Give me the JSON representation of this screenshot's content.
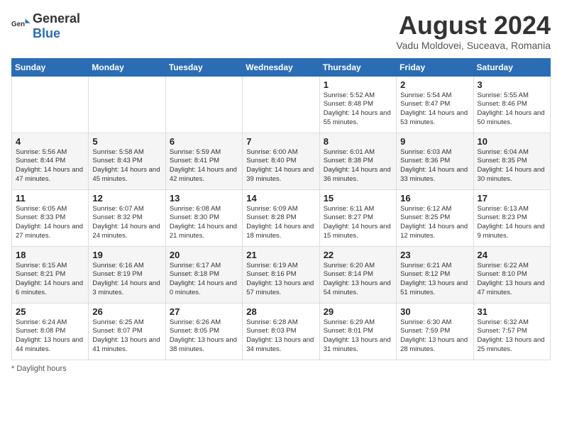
{
  "header": {
    "logo_general": "General",
    "logo_blue": "Blue",
    "month_year": "August 2024",
    "location": "Vadu Moldovei, Suceava, Romania"
  },
  "days_of_week": [
    "Sunday",
    "Monday",
    "Tuesday",
    "Wednesday",
    "Thursday",
    "Friday",
    "Saturday"
  ],
  "footer": {
    "daylight_label": "Daylight hours"
  },
  "weeks": [
    [
      {
        "day": "",
        "detail": ""
      },
      {
        "day": "",
        "detail": ""
      },
      {
        "day": "",
        "detail": ""
      },
      {
        "day": "",
        "detail": ""
      },
      {
        "day": "1",
        "detail": "Sunrise: 5:52 AM\nSunset: 8:48 PM\nDaylight: 14 hours\nand 55 minutes."
      },
      {
        "day": "2",
        "detail": "Sunrise: 5:54 AM\nSunset: 8:47 PM\nDaylight: 14 hours\nand 53 minutes."
      },
      {
        "day": "3",
        "detail": "Sunrise: 5:55 AM\nSunset: 8:46 PM\nDaylight: 14 hours\nand 50 minutes."
      }
    ],
    [
      {
        "day": "4",
        "detail": "Sunrise: 5:56 AM\nSunset: 8:44 PM\nDaylight: 14 hours\nand 47 minutes."
      },
      {
        "day": "5",
        "detail": "Sunrise: 5:58 AM\nSunset: 8:43 PM\nDaylight: 14 hours\nand 45 minutes."
      },
      {
        "day": "6",
        "detail": "Sunrise: 5:59 AM\nSunset: 8:41 PM\nDaylight: 14 hours\nand 42 minutes."
      },
      {
        "day": "7",
        "detail": "Sunrise: 6:00 AM\nSunset: 8:40 PM\nDaylight: 14 hours\nand 39 minutes."
      },
      {
        "day": "8",
        "detail": "Sunrise: 6:01 AM\nSunset: 8:38 PM\nDaylight: 14 hours\nand 36 minutes."
      },
      {
        "day": "9",
        "detail": "Sunrise: 6:03 AM\nSunset: 8:36 PM\nDaylight: 14 hours\nand 33 minutes."
      },
      {
        "day": "10",
        "detail": "Sunrise: 6:04 AM\nSunset: 8:35 PM\nDaylight: 14 hours\nand 30 minutes."
      }
    ],
    [
      {
        "day": "11",
        "detail": "Sunrise: 6:05 AM\nSunset: 8:33 PM\nDaylight: 14 hours\nand 27 minutes."
      },
      {
        "day": "12",
        "detail": "Sunrise: 6:07 AM\nSunset: 8:32 PM\nDaylight: 14 hours\nand 24 minutes."
      },
      {
        "day": "13",
        "detail": "Sunrise: 6:08 AM\nSunset: 8:30 PM\nDaylight: 14 hours\nand 21 minutes."
      },
      {
        "day": "14",
        "detail": "Sunrise: 6:09 AM\nSunset: 8:28 PM\nDaylight: 14 hours\nand 18 minutes."
      },
      {
        "day": "15",
        "detail": "Sunrise: 6:11 AM\nSunset: 8:27 PM\nDaylight: 14 hours\nand 15 minutes."
      },
      {
        "day": "16",
        "detail": "Sunrise: 6:12 AM\nSunset: 8:25 PM\nDaylight: 14 hours\nand 12 minutes."
      },
      {
        "day": "17",
        "detail": "Sunrise: 6:13 AM\nSunset: 8:23 PM\nDaylight: 14 hours\nand 9 minutes."
      }
    ],
    [
      {
        "day": "18",
        "detail": "Sunrise: 6:15 AM\nSunset: 8:21 PM\nDaylight: 14 hours\nand 6 minutes."
      },
      {
        "day": "19",
        "detail": "Sunrise: 6:16 AM\nSunset: 8:19 PM\nDaylight: 14 hours\nand 3 minutes."
      },
      {
        "day": "20",
        "detail": "Sunrise: 6:17 AM\nSunset: 8:18 PM\nDaylight: 14 hours and 0 minutes."
      },
      {
        "day": "21",
        "detail": "Sunrise: 6:19 AM\nSunset: 8:16 PM\nDaylight: 13 hours\nand 57 minutes."
      },
      {
        "day": "22",
        "detail": "Sunrise: 6:20 AM\nSunset: 8:14 PM\nDaylight: 13 hours\nand 54 minutes."
      },
      {
        "day": "23",
        "detail": "Sunrise: 6:21 AM\nSunset: 8:12 PM\nDaylight: 13 hours\nand 51 minutes."
      },
      {
        "day": "24",
        "detail": "Sunrise: 6:22 AM\nSunset: 8:10 PM\nDaylight: 13 hours\nand 47 minutes."
      }
    ],
    [
      {
        "day": "25",
        "detail": "Sunrise: 6:24 AM\nSunset: 8:08 PM\nDaylight: 13 hours\nand 44 minutes."
      },
      {
        "day": "26",
        "detail": "Sunrise: 6:25 AM\nSunset: 8:07 PM\nDaylight: 13 hours\nand 41 minutes."
      },
      {
        "day": "27",
        "detail": "Sunrise: 6:26 AM\nSunset: 8:05 PM\nDaylight: 13 hours\nand 38 minutes."
      },
      {
        "day": "28",
        "detail": "Sunrise: 6:28 AM\nSunset: 8:03 PM\nDaylight: 13 hours\nand 34 minutes."
      },
      {
        "day": "29",
        "detail": "Sunrise: 6:29 AM\nSunset: 8:01 PM\nDaylight: 13 hours\nand 31 minutes."
      },
      {
        "day": "30",
        "detail": "Sunrise: 6:30 AM\nSunset: 7:59 PM\nDaylight: 13 hours\nand 28 minutes."
      },
      {
        "day": "31",
        "detail": "Sunrise: 6:32 AM\nSunset: 7:57 PM\nDaylight: 13 hours\nand 25 minutes."
      }
    ]
  ]
}
